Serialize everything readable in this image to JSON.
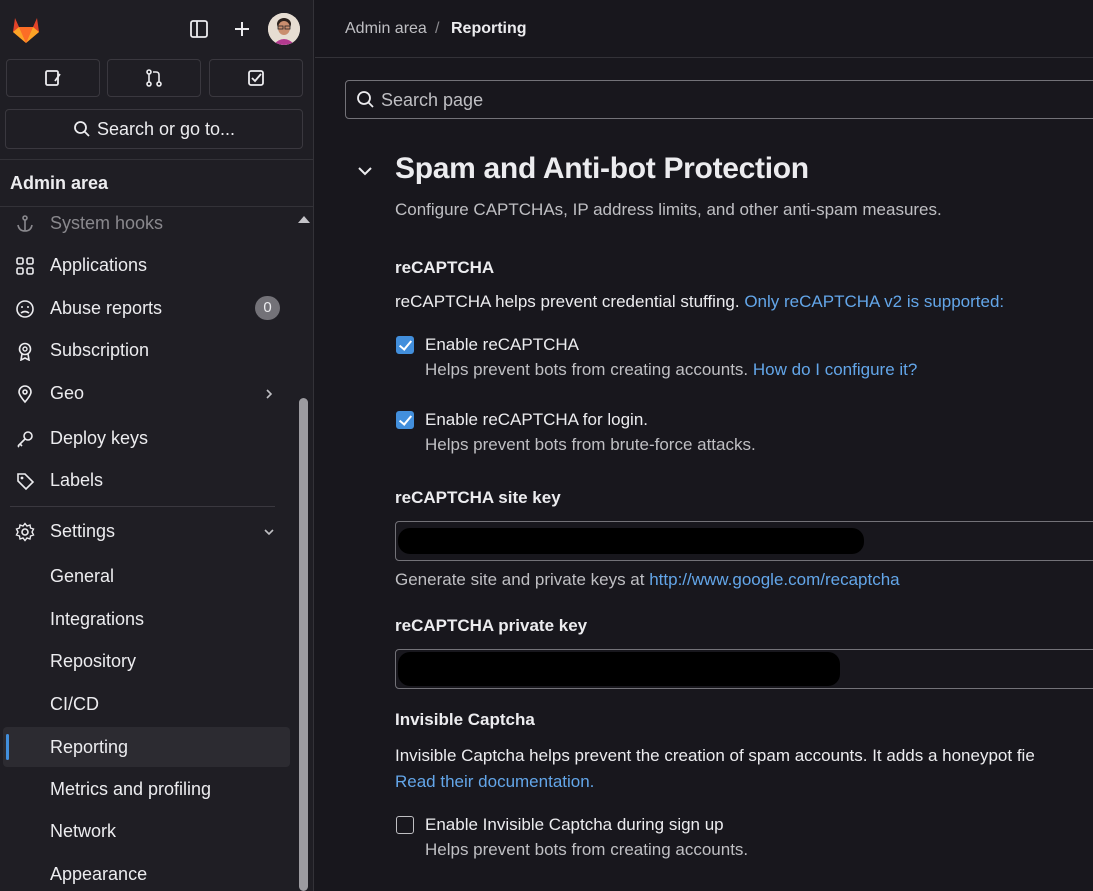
{
  "sidebar": {
    "search_label": "Search or go to...",
    "context_title": "Admin area",
    "items": [
      {
        "label": "System hooks",
        "icon": "anchor-icon"
      },
      {
        "label": "Applications",
        "icon": "applications-icon"
      },
      {
        "label": "Abuse reports",
        "icon": "abuse-icon",
        "badge": "0"
      },
      {
        "label": "Subscription",
        "icon": "license-icon"
      },
      {
        "label": "Geo",
        "icon": "location-icon"
      },
      {
        "label": "Deploy keys",
        "icon": "key-icon"
      },
      {
        "label": "Labels",
        "icon": "labels-icon"
      },
      {
        "label": "Settings",
        "icon": "settings-icon"
      }
    ],
    "settings_sub": [
      {
        "label": "General"
      },
      {
        "label": "Integrations"
      },
      {
        "label": "Repository"
      },
      {
        "label": "CI/CD"
      },
      {
        "label": "Reporting"
      },
      {
        "label": "Metrics and profiling"
      },
      {
        "label": "Network"
      },
      {
        "label": "Appearance"
      }
    ]
  },
  "breadcrumb": {
    "parent": "Admin area",
    "separator": "/",
    "current": "Reporting"
  },
  "search": {
    "placeholder": "Search page"
  },
  "section": {
    "title": "Spam and Anti-bot Protection",
    "description": "Configure CAPTCHAs, IP address limits, and other anti-spam measures."
  },
  "recaptcha": {
    "heading": "reCAPTCHA",
    "intro": "reCAPTCHA helps prevent credential stuffing.",
    "intro_link": "Only reCAPTCHA v2 is supported:",
    "enable_label": "Enable reCAPTCHA",
    "enable_help": "Helps prevent bots from creating accounts.",
    "enable_help_link": "How do I configure it?",
    "enable_checked": true,
    "login_label": "Enable reCAPTCHA for login.",
    "login_help": "Helps prevent bots from brute-force attacks.",
    "login_checked": true,
    "site_key_label": "reCAPTCHA site key",
    "site_key_help": "Generate site and private keys at",
    "site_key_help_link": "http://www.google.com/recaptcha",
    "private_key_label": "reCAPTCHA private key"
  },
  "invisible": {
    "heading": "Invisible Captcha",
    "intro": "Invisible Captcha helps prevent the creation of spam accounts. It adds a honeypot fie",
    "docs_link": "Read their documentation.",
    "enable_label": "Enable Invisible Captcha during sign up",
    "enable_help": "Helps prevent bots from creating accounts.",
    "enable_checked": false
  },
  "colors": {
    "accent": "#428fdc",
    "link": "#63a6e9",
    "background": "#18171d",
    "sidebar": "#1f1e24"
  }
}
